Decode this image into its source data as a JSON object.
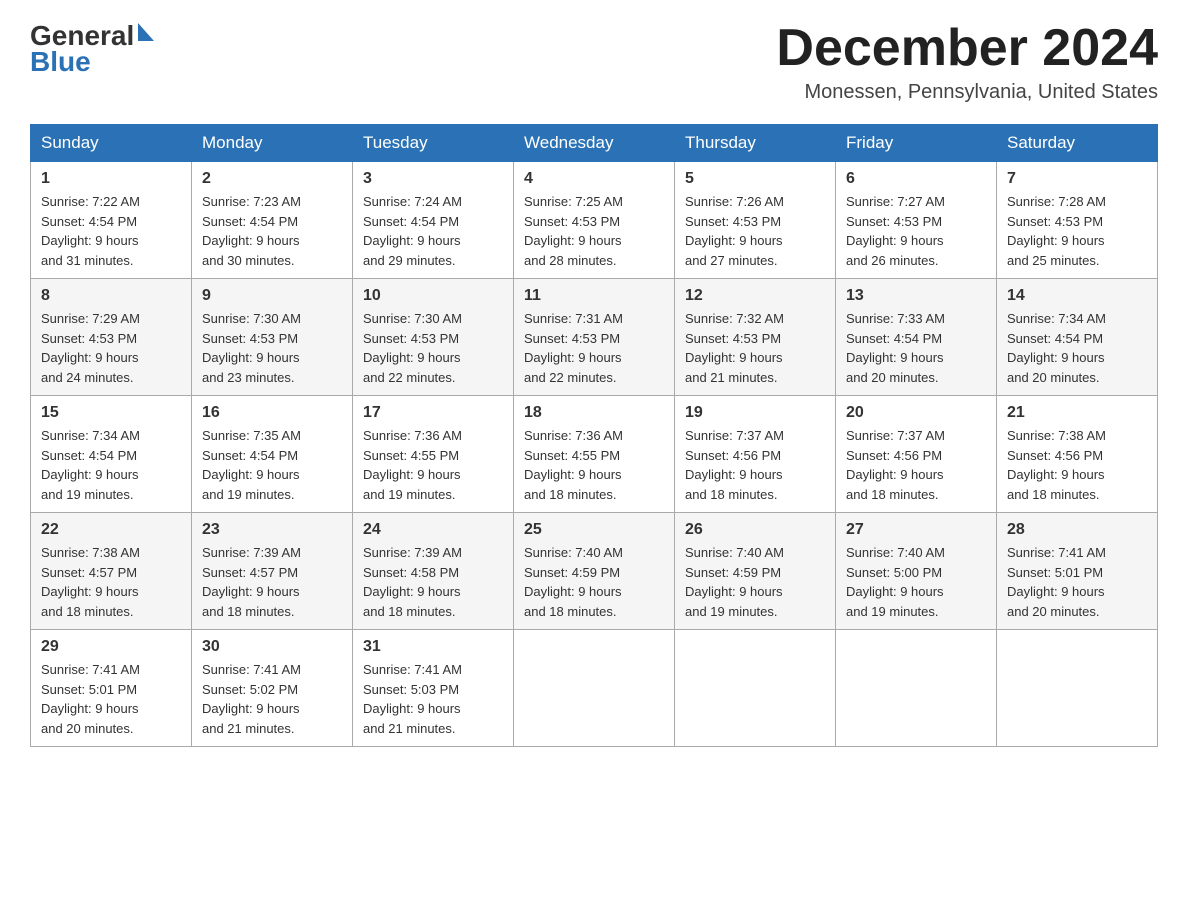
{
  "header": {
    "logo_general": "General",
    "logo_blue": "Blue",
    "month_title": "December 2024",
    "location": "Monessen, Pennsylvania, United States"
  },
  "weekdays": [
    "Sunday",
    "Monday",
    "Tuesday",
    "Wednesday",
    "Thursday",
    "Friday",
    "Saturday"
  ],
  "weeks": [
    [
      {
        "day": 1,
        "sunrise": "7:22 AM",
        "sunset": "4:54 PM",
        "daylight": "9 hours and 31 minutes."
      },
      {
        "day": 2,
        "sunrise": "7:23 AM",
        "sunset": "4:54 PM",
        "daylight": "9 hours and 30 minutes."
      },
      {
        "day": 3,
        "sunrise": "7:24 AM",
        "sunset": "4:54 PM",
        "daylight": "9 hours and 29 minutes."
      },
      {
        "day": 4,
        "sunrise": "7:25 AM",
        "sunset": "4:53 PM",
        "daylight": "9 hours and 28 minutes."
      },
      {
        "day": 5,
        "sunrise": "7:26 AM",
        "sunset": "4:53 PM",
        "daylight": "9 hours and 27 minutes."
      },
      {
        "day": 6,
        "sunrise": "7:27 AM",
        "sunset": "4:53 PM",
        "daylight": "9 hours and 26 minutes."
      },
      {
        "day": 7,
        "sunrise": "7:28 AM",
        "sunset": "4:53 PM",
        "daylight": "9 hours and 25 minutes."
      }
    ],
    [
      {
        "day": 8,
        "sunrise": "7:29 AM",
        "sunset": "4:53 PM",
        "daylight": "9 hours and 24 minutes."
      },
      {
        "day": 9,
        "sunrise": "7:30 AM",
        "sunset": "4:53 PM",
        "daylight": "9 hours and 23 minutes."
      },
      {
        "day": 10,
        "sunrise": "7:30 AM",
        "sunset": "4:53 PM",
        "daylight": "9 hours and 22 minutes."
      },
      {
        "day": 11,
        "sunrise": "7:31 AM",
        "sunset": "4:53 PM",
        "daylight": "9 hours and 22 minutes."
      },
      {
        "day": 12,
        "sunrise": "7:32 AM",
        "sunset": "4:53 PM",
        "daylight": "9 hours and 21 minutes."
      },
      {
        "day": 13,
        "sunrise": "7:33 AM",
        "sunset": "4:54 PM",
        "daylight": "9 hours and 20 minutes."
      },
      {
        "day": 14,
        "sunrise": "7:34 AM",
        "sunset": "4:54 PM",
        "daylight": "9 hours and 20 minutes."
      }
    ],
    [
      {
        "day": 15,
        "sunrise": "7:34 AM",
        "sunset": "4:54 PM",
        "daylight": "9 hours and 19 minutes."
      },
      {
        "day": 16,
        "sunrise": "7:35 AM",
        "sunset": "4:54 PM",
        "daylight": "9 hours and 19 minutes."
      },
      {
        "day": 17,
        "sunrise": "7:36 AM",
        "sunset": "4:55 PM",
        "daylight": "9 hours and 19 minutes."
      },
      {
        "day": 18,
        "sunrise": "7:36 AM",
        "sunset": "4:55 PM",
        "daylight": "9 hours and 18 minutes."
      },
      {
        "day": 19,
        "sunrise": "7:37 AM",
        "sunset": "4:56 PM",
        "daylight": "9 hours and 18 minutes."
      },
      {
        "day": 20,
        "sunrise": "7:37 AM",
        "sunset": "4:56 PM",
        "daylight": "9 hours and 18 minutes."
      },
      {
        "day": 21,
        "sunrise": "7:38 AM",
        "sunset": "4:56 PM",
        "daylight": "9 hours and 18 minutes."
      }
    ],
    [
      {
        "day": 22,
        "sunrise": "7:38 AM",
        "sunset": "4:57 PM",
        "daylight": "9 hours and 18 minutes."
      },
      {
        "day": 23,
        "sunrise": "7:39 AM",
        "sunset": "4:57 PM",
        "daylight": "9 hours and 18 minutes."
      },
      {
        "day": 24,
        "sunrise": "7:39 AM",
        "sunset": "4:58 PM",
        "daylight": "9 hours and 18 minutes."
      },
      {
        "day": 25,
        "sunrise": "7:40 AM",
        "sunset": "4:59 PM",
        "daylight": "9 hours and 18 minutes."
      },
      {
        "day": 26,
        "sunrise": "7:40 AM",
        "sunset": "4:59 PM",
        "daylight": "9 hours and 19 minutes."
      },
      {
        "day": 27,
        "sunrise": "7:40 AM",
        "sunset": "5:00 PM",
        "daylight": "9 hours and 19 minutes."
      },
      {
        "day": 28,
        "sunrise": "7:41 AM",
        "sunset": "5:01 PM",
        "daylight": "9 hours and 20 minutes."
      }
    ],
    [
      {
        "day": 29,
        "sunrise": "7:41 AM",
        "sunset": "5:01 PM",
        "daylight": "9 hours and 20 minutes."
      },
      {
        "day": 30,
        "sunrise": "7:41 AM",
        "sunset": "5:02 PM",
        "daylight": "9 hours and 21 minutes."
      },
      {
        "day": 31,
        "sunrise": "7:41 AM",
        "sunset": "5:03 PM",
        "daylight": "9 hours and 21 minutes."
      },
      null,
      null,
      null,
      null
    ]
  ],
  "labels": {
    "sunrise": "Sunrise:",
    "sunset": "Sunset:",
    "daylight": "Daylight:"
  }
}
